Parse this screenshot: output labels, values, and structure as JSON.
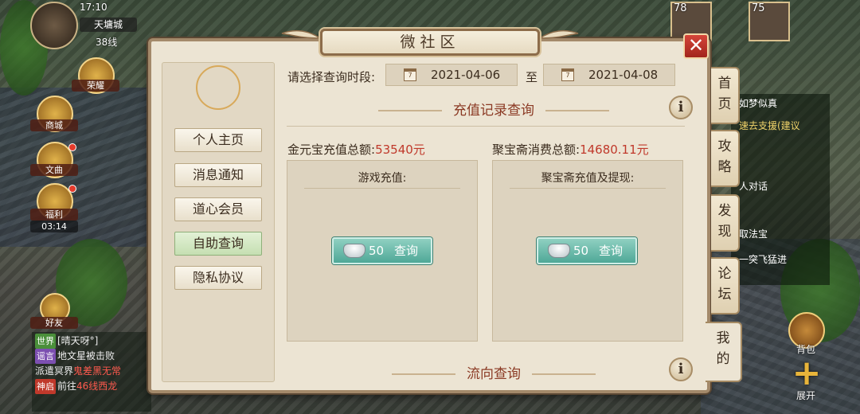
{
  "hud": {
    "time": "17:10",
    "map_name": "天墉城",
    "line": "38线",
    "level_left": "78",
    "level_right": "75"
  },
  "left_icons": [
    {
      "label": "荣耀"
    },
    {
      "label": "商城"
    },
    {
      "label": "文曲"
    },
    {
      "label": "福利",
      "sub": "03:14"
    },
    {
      "label": "好友"
    }
  ],
  "chat": [
    {
      "tag": "世界",
      "text": "[晴天呀°]",
      "tag_color": "#4a8f3a"
    },
    {
      "tag": "谣言",
      "text": "地文星被击败",
      "tag_color": "#7c4fb0"
    },
    {
      "tag": "",
      "text_a": "派遣冥界",
      "text_b": "鬼差黑无常"
    },
    {
      "tag": "神启",
      "text_a": "前往",
      "text_b": "46线西龙"
    }
  ],
  "quests": [
    {
      "text": "如梦似真"
    },
    {
      "text": "速去支援(建议"
    },
    {
      "text": "人对话"
    },
    {
      "text": "取法宝"
    },
    {
      "text": "一突飞猛进"
    }
  ],
  "right_labels": {
    "bag": "背包",
    "expand": "展开"
  },
  "dialog": {
    "title": "微社区",
    "close": "✕"
  },
  "sidebar": {
    "items": [
      {
        "label": "个人主页"
      },
      {
        "label": "消息通知"
      },
      {
        "label": "道心会员"
      },
      {
        "label": "自助查询",
        "active": true
      },
      {
        "label": "隐私协议"
      }
    ]
  },
  "query": {
    "period_label": "请选择查询时段:",
    "start_date": "2021-04-06",
    "to_label": "至",
    "end_date": "2021-04-08",
    "calendar_day": "7"
  },
  "recharge": {
    "section_title": "充值记录查询",
    "gold_total_label": "金元宝充值总额:",
    "gold_total_value": "53540元",
    "jbz_total_label": "聚宝斋消费总额:",
    "jbz_total_value": "14680.11元",
    "card_left_title": "游戏充值:",
    "card_right_title": "聚宝斋充值及提现:",
    "query_cost": "50",
    "query_label": "查询"
  },
  "flow": {
    "section_title": "流向查询"
  },
  "tabs": [
    {
      "label": "首页"
    },
    {
      "label": "攻略"
    },
    {
      "label": "发现"
    },
    {
      "label": "论坛"
    },
    {
      "label": "我的",
      "active": true
    }
  ],
  "colors": {
    "accent_red": "#c0392b",
    "query_button": "#4fa897",
    "active_side": "#c5dfb2",
    "panel_bg": "#ece4d3"
  }
}
